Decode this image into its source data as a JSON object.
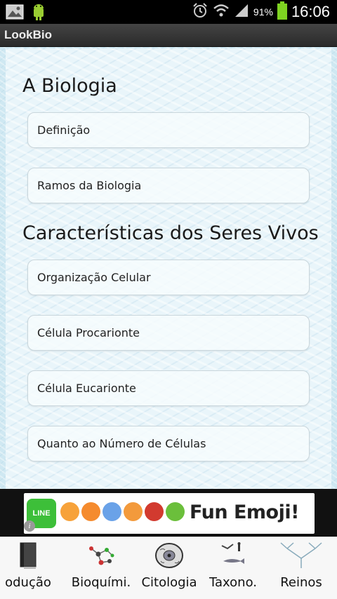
{
  "status_bar": {
    "battery_percent": "91%",
    "time": "16:06",
    "icons": [
      "picture-icon",
      "android-icon",
      "alarm-icon",
      "wifi-icon",
      "signal-icon",
      "battery-icon"
    ]
  },
  "app": {
    "title": "LookBio"
  },
  "sections": [
    {
      "heading": "A Biologia",
      "items": [
        "Definição",
        "Ramos da Biologia"
      ]
    },
    {
      "heading": "Características dos Seres Vivos",
      "items": [
        "Organização Celular",
        "Célula Procarionte",
        "Célula Eucarionte",
        "Quanto ao Número de Células"
      ]
    }
  ],
  "ad": {
    "line_label": "LINE",
    "headline": "Fun Emoji!",
    "info_symbol": "i"
  },
  "tabs": [
    {
      "label": "odução",
      "icon": "book-icon"
    },
    {
      "label": "Bioquími.",
      "icon": "molecule-icon"
    },
    {
      "label": "Citologia",
      "icon": "cell-icon"
    },
    {
      "label": "Taxono.",
      "icon": "taxonomy-icon"
    },
    {
      "label": "Reinos",
      "icon": "tree-icon"
    }
  ],
  "colors": {
    "content_bg": "#e9f5fa",
    "ad_line_green": "#3dbf39",
    "status_battery": "#7ed321"
  }
}
